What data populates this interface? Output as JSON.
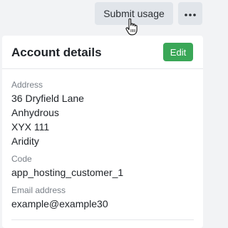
{
  "toolbar": {
    "submit_label": "Submit usage",
    "more_icon": "ellipsis-icon"
  },
  "cursor": {
    "icon": "hand-pointer-icon"
  },
  "card": {
    "title": "Account details",
    "edit_label": "Edit",
    "fields": {
      "address": {
        "label": "Address",
        "lines": [
          "36 Dryfield Lane",
          "Anhydrous",
          "XYX 111",
          "Aridity"
        ]
      },
      "code": {
        "label": "Code",
        "value": "app_hosting_customer_1"
      },
      "email": {
        "label": "Email address",
        "value": "example@example30"
      }
    }
  },
  "colors": {
    "page_bg": "#f2f3f5",
    "card_bg": "#ffffff",
    "button_bg": "#e1e5ea",
    "edit_green": "#3aa757",
    "label_gray": "#7a8088"
  }
}
